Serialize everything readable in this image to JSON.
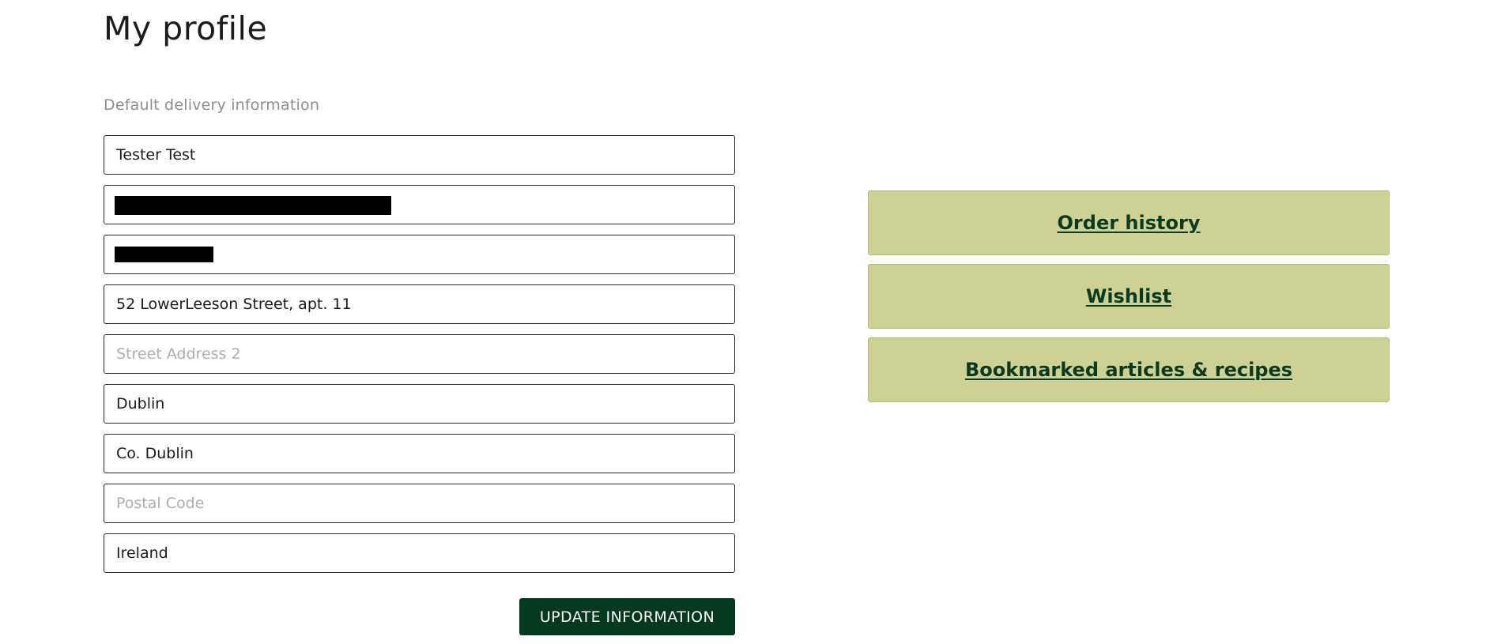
{
  "page": {
    "title": "My profile",
    "section_label": "Default delivery information"
  },
  "form": {
    "full_name": {
      "value": "Tester Test",
      "placeholder": ""
    },
    "field_2_redacted": {
      "value": "",
      "placeholder": ""
    },
    "field_3_redacted": {
      "value": "",
      "placeholder": ""
    },
    "street_address_1": {
      "value": "52 LowerLeeson Street, apt. 11",
      "placeholder": ""
    },
    "street_address_2": {
      "value": "",
      "placeholder": "Street Address 2"
    },
    "city": {
      "value": "Dublin",
      "placeholder": ""
    },
    "county": {
      "value": "Co. Dublin",
      "placeholder": ""
    },
    "postal_code": {
      "value": "",
      "placeholder": "Postal Code"
    },
    "country": {
      "value": "Ireland",
      "placeholder": ""
    },
    "submit_label": "UPDATE INFORMATION"
  },
  "links": {
    "order_history": "Order history",
    "wishlist": "Wishlist",
    "bookmarks": "Bookmarked articles & recipes"
  },
  "colors": {
    "button_bg": "#033a1f",
    "card_bg": "#cdd194",
    "link_text": "#0b3a1f"
  }
}
